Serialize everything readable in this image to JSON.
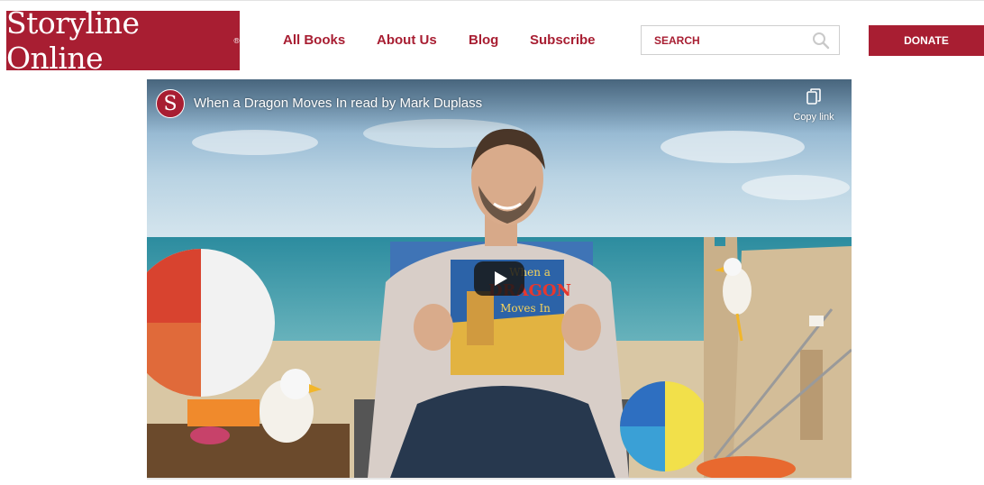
{
  "brand": {
    "name": "Storyline Online",
    "mark": "®"
  },
  "nav": {
    "items": [
      {
        "label": "All Books"
      },
      {
        "label": "About Us"
      },
      {
        "label": "Blog"
      },
      {
        "label": "Subscribe"
      }
    ]
  },
  "search": {
    "placeholder": "SEARCH",
    "value": ""
  },
  "donate": {
    "label": "DONATE"
  },
  "video": {
    "channel_initial": "S",
    "title": "When a Dragon Moves In read by Mark Duplass",
    "copy_label": "Copy link",
    "book_cover_title_line1": "When a",
    "book_cover_title_line2": "DRAGON",
    "book_cover_title_line3": "Moves In"
  },
  "colors": {
    "brand": "#a81e32",
    "white": "#ffffff"
  },
  "icons": {
    "search": "search-icon",
    "copy": "copy-icon",
    "play": "play-icon"
  }
}
